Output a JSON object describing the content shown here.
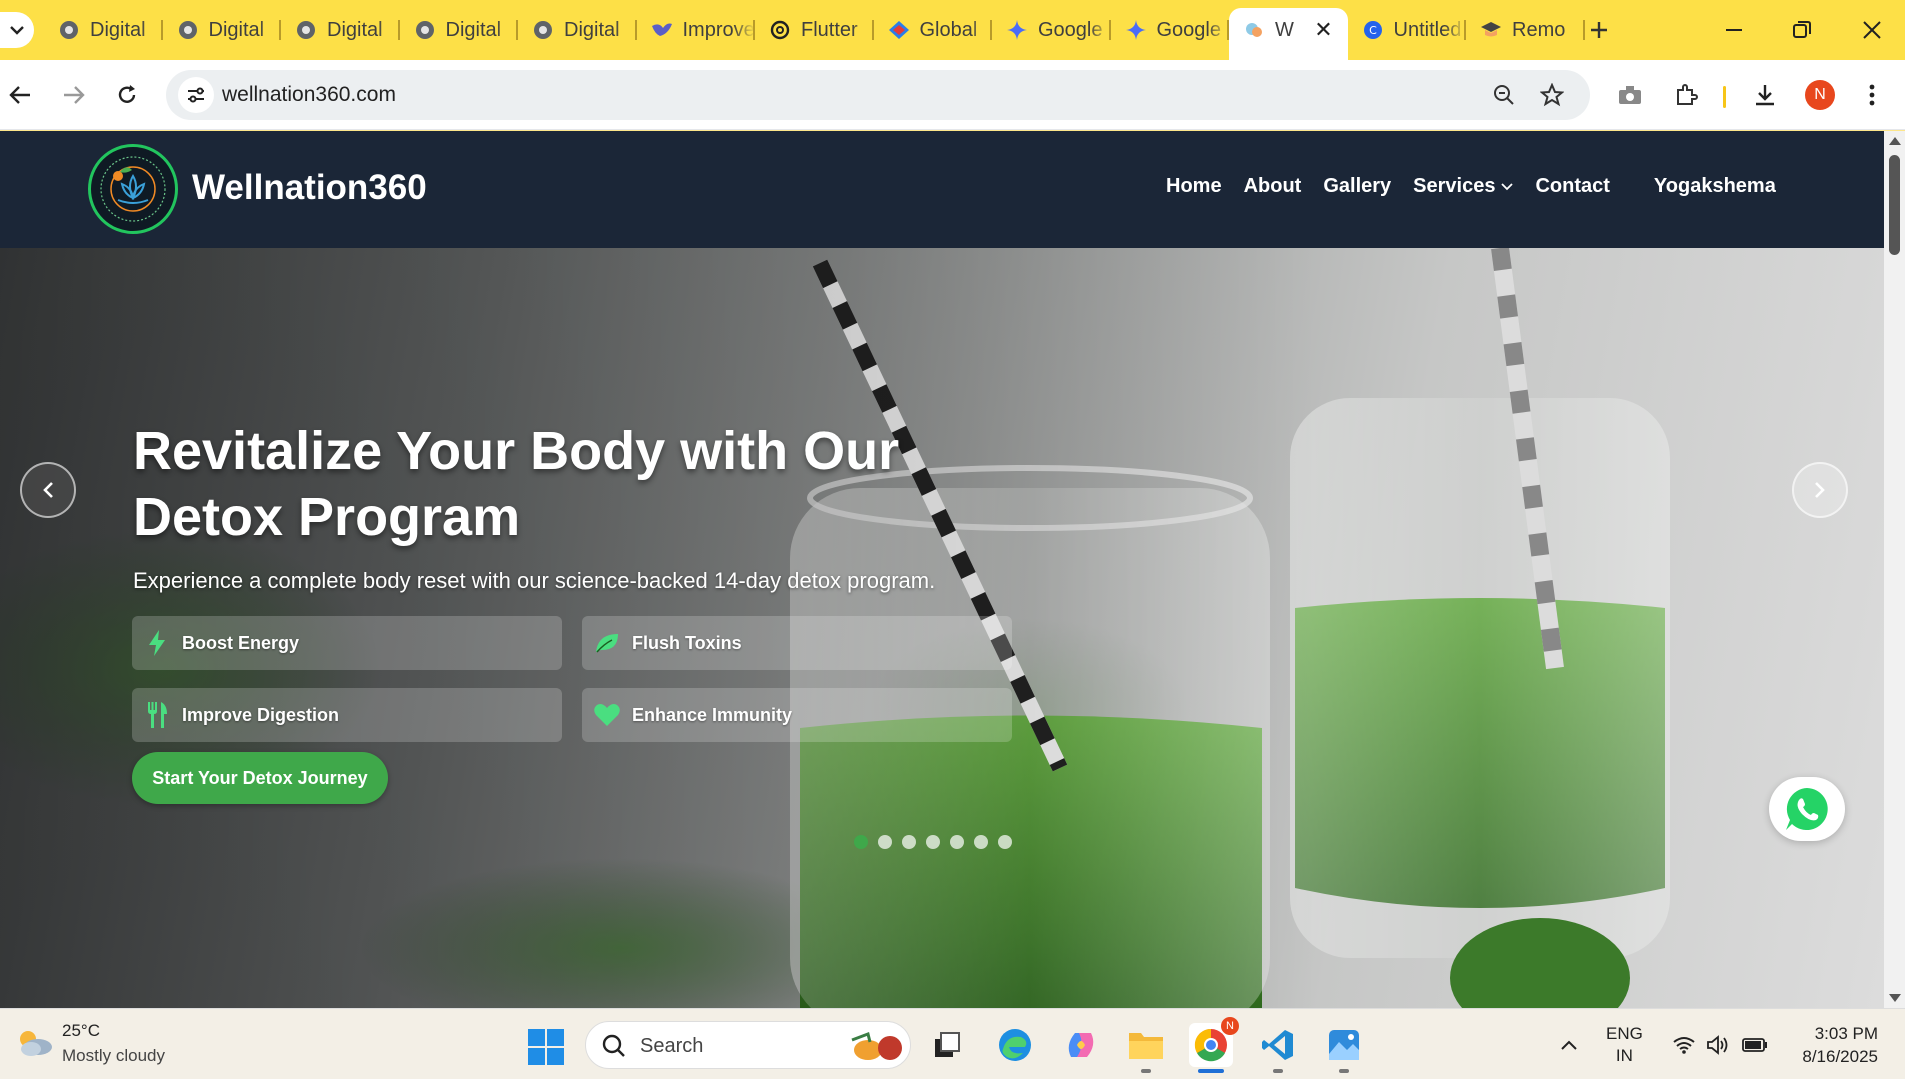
{
  "browser": {
    "tabs": [
      {
        "title": "Digital",
        "icon": "globe-icon",
        "color": "#5f6368"
      },
      {
        "title": "Digital",
        "icon": "globe-icon",
        "color": "#5f6368"
      },
      {
        "title": "Digital",
        "icon": "globe-icon",
        "color": "#5f6368"
      },
      {
        "title": "Digital",
        "icon": "globe-icon",
        "color": "#5f6368"
      },
      {
        "title": "Digital",
        "icon": "globe-icon",
        "color": "#5f6368"
      },
      {
        "title": "Improve",
        "icon": "bird-icon",
        "color": "#5b5fc7"
      },
      {
        "title": "Flutter",
        "icon": "openai-icon",
        "color": "#222222"
      },
      {
        "title": "Global",
        "icon": "diamond-icon",
        "color": "#2b7de9"
      },
      {
        "title": "Google",
        "icon": "gemini-icon",
        "color": "#4a6cf7"
      },
      {
        "title": "Google",
        "icon": "gemini-icon",
        "color": "#4a6cf7"
      },
      {
        "title": "W",
        "icon": "site-icon",
        "color": "#8ecae6",
        "active": true
      },
      {
        "title": "Untitled",
        "icon": "canva-icon",
        "color": "#2563eb"
      },
      {
        "title": "Remo",
        "icon": "hat-icon",
        "color": "#444444"
      }
    ],
    "url": "wellnation360.com"
  },
  "site": {
    "name": "Wellnation360",
    "nav": {
      "home": "Home",
      "about": "About",
      "gallery": "Gallery",
      "services": "Services",
      "contact": "Contact",
      "yogakshema": "Yogakshema"
    },
    "hero": {
      "title": "Revitalize Your Body with Our Detox Program",
      "subtitle": "Experience a complete body reset with our science-backed 14-day detox program.",
      "features": [
        {
          "label": "Boost Energy",
          "icon": "bolt-icon"
        },
        {
          "label": "Flush Toxins",
          "icon": "leaf-icon"
        },
        {
          "label": "Improve Digestion",
          "icon": "utensils-icon"
        },
        {
          "label": "Enhance Immunity",
          "icon": "heart-icon"
        }
      ],
      "cta": "Start Your Detox Journey",
      "slide_count": 7,
      "active_slide": 1
    },
    "accent_color": "#3fa84a",
    "header_color": "#1b2637"
  },
  "taskbar": {
    "weather_temp": "25°C",
    "weather_desc": "Mostly cloudy",
    "search_placeholder": "Search",
    "lang_line1": "ENG",
    "lang_line2": "IN",
    "time": "3:03 PM",
    "date": "8/16/2025",
    "chrome_badge": "N"
  },
  "profile_initial": "N"
}
